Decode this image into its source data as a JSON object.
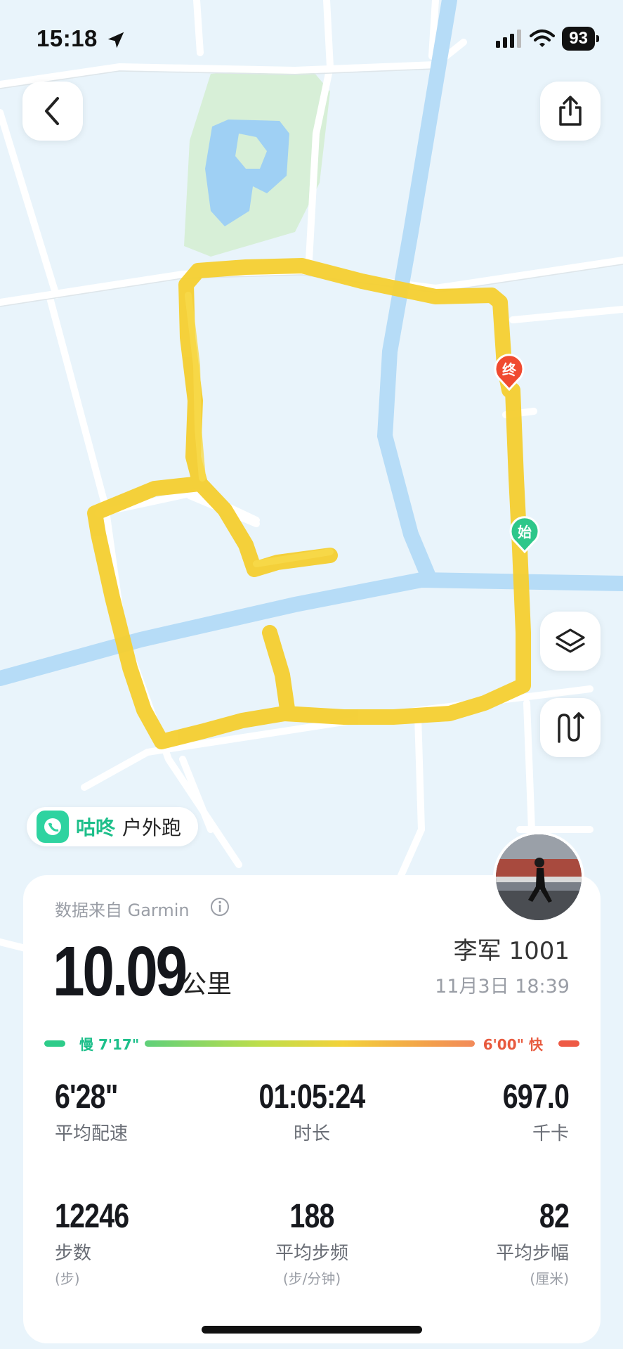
{
  "status_bar": {
    "time": "15:18",
    "battery": "93"
  },
  "map": {
    "start_marker": "始",
    "end_marker": "终",
    "route_color": "#f5cf33"
  },
  "activity": {
    "app_name": "咕咚",
    "sport_type": "户外跑",
    "data_source": "数据来自 Garmin",
    "distance": "10.09",
    "distance_unit": "公里",
    "user_name": "李军 1001",
    "datetime": "11月3日 18:39",
    "pace_slow": "慢 7'17\"",
    "pace_fast": "6'00\" 快"
  },
  "stats": [
    {
      "value": "6'28\"",
      "label": "平均配速"
    },
    {
      "value": "01:05:24",
      "label": "时长"
    },
    {
      "value": "697.0",
      "label": "千卡"
    },
    {
      "value": "12246",
      "label": "步数",
      "sub": "(步)"
    },
    {
      "value": "188",
      "label": "平均步频",
      "sub": "(步/分钟)"
    },
    {
      "value": "82",
      "label": "平均步幅",
      "sub": "(厘米)"
    }
  ],
  "icons": {
    "back": "chevron-left-icon",
    "share": "share-icon",
    "layers": "layers-icon",
    "route": "route-icon",
    "info": "info-icon"
  }
}
